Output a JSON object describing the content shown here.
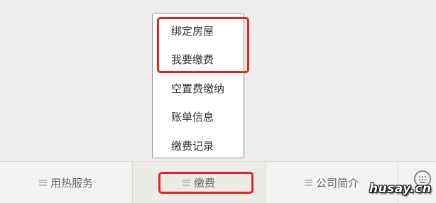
{
  "popup_menu": {
    "items": [
      {
        "label": "绑定房屋"
      },
      {
        "label": "我要缴费"
      },
      {
        "label": "空置费缴纳"
      },
      {
        "label": "账单信息"
      },
      {
        "label": "缴费记录"
      }
    ]
  },
  "tabbar": {
    "tabs": [
      {
        "label": "用热服务",
        "icon": "menu-icon"
      },
      {
        "label": "缴费",
        "icon": "menu-icon",
        "active": true
      },
      {
        "label": "公司简介",
        "icon": "menu-icon"
      }
    ],
    "keyboard_icon": "keyboard-icon"
  },
  "watermark": {
    "text": "husay.cn"
  },
  "colors": {
    "highlight": "#e8221f",
    "background": "#eeeeee",
    "tabbar": "#f3f3f1",
    "active_tab": "#ecece7"
  }
}
